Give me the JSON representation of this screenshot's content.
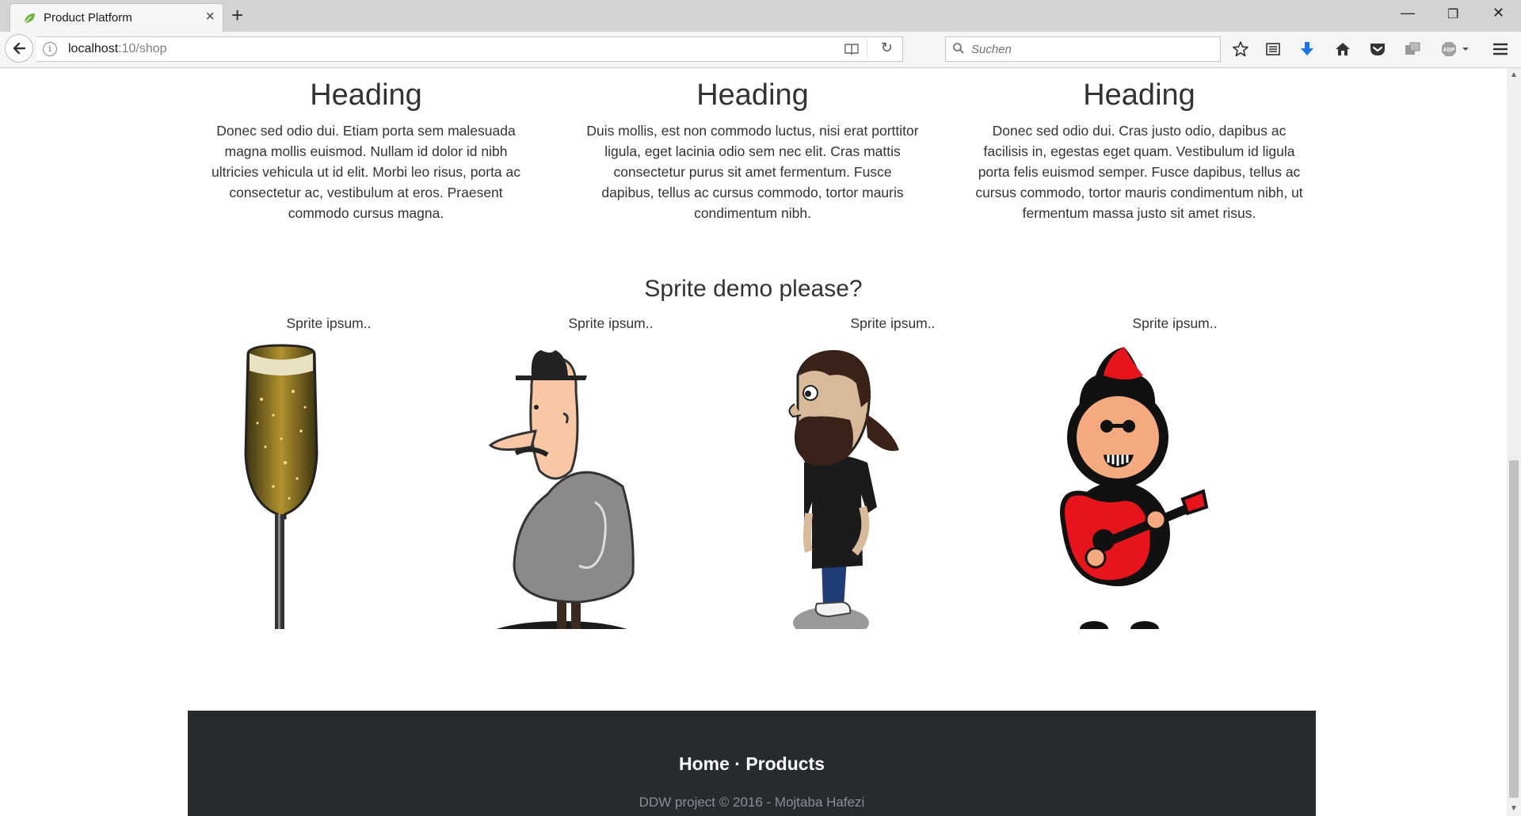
{
  "browser": {
    "tab_title": "Product Platform",
    "url_host": "localhost",
    "url_rest": ":10/shop",
    "search_placeholder": "Suchen",
    "minimize_glyph": "—",
    "restore_glyph": "❐",
    "close_glyph": "✕"
  },
  "columns": [
    {
      "heading": "Heading",
      "text": "Donec sed odio dui. Etiam porta sem malesuada magna mollis euismod. Nullam id dolor id nibh ultricies vehicula ut id elit. Morbi leo risus, porta ac consectetur ac, vestibulum at eros. Praesent commodo cursus magna."
    },
    {
      "heading": "Heading",
      "text": "Duis mollis, est non commodo luctus, nisi erat porttitor ligula, eget lacinia odio sem nec elit. Cras mattis consectetur purus sit amet fermentum. Fusce dapibus, tellus ac cursus commodo, tortor mauris condimentum nibh."
    },
    {
      "heading": "Heading",
      "text": "Donec sed odio dui. Cras justo odio, dapibus ac facilisis in, egestas eget quam. Vestibulum id ligula porta felis euismod semper. Fusce dapibus, tellus ac cursus commodo, tortor mauris condimentum nibh, ut fermentum massa justo sit amet risus."
    }
  ],
  "sprites": {
    "title": "Sprite demo please?",
    "items": [
      {
        "caption": "Sprite ipsum..",
        "icon": "champagne-glass"
      },
      {
        "caption": "Sprite ipsum..",
        "icon": "man-with-hat"
      },
      {
        "caption": "Sprite ipsum..",
        "icon": "bearded-man"
      },
      {
        "caption": "Sprite ipsum..",
        "icon": "punk-guitarist"
      }
    ]
  },
  "footer": {
    "home": "Home",
    "separator": "·",
    "products": "Products",
    "copyright": "DDW project © 2016 - Mojtaba Hafezi"
  },
  "colors": {
    "footer_bg": "#272b30",
    "download_blue": "#1a73e8",
    "punk_red": "#e8141b"
  }
}
